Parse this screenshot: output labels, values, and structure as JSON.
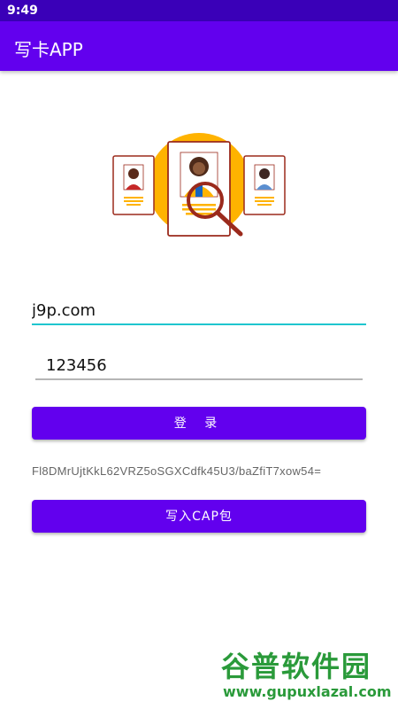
{
  "status_bar": {
    "time": "9:49"
  },
  "app_bar": {
    "title": "写卡APP"
  },
  "login": {
    "username_value": "j9p.com",
    "password_value": "123456",
    "login_label": "登 录"
  },
  "token": {
    "text": "Fl8DMrUjtKkL62VRZ5oSGXCdfk45U3/baZfiT7xow54="
  },
  "write": {
    "label": "写入CAP包"
  },
  "watermark": {
    "title": "谷普软件园",
    "url": "www.gupuxlazal.com"
  },
  "colors": {
    "primary": "#6200ee",
    "status": "#3a00b8",
    "accent": "#1fc6cf"
  }
}
